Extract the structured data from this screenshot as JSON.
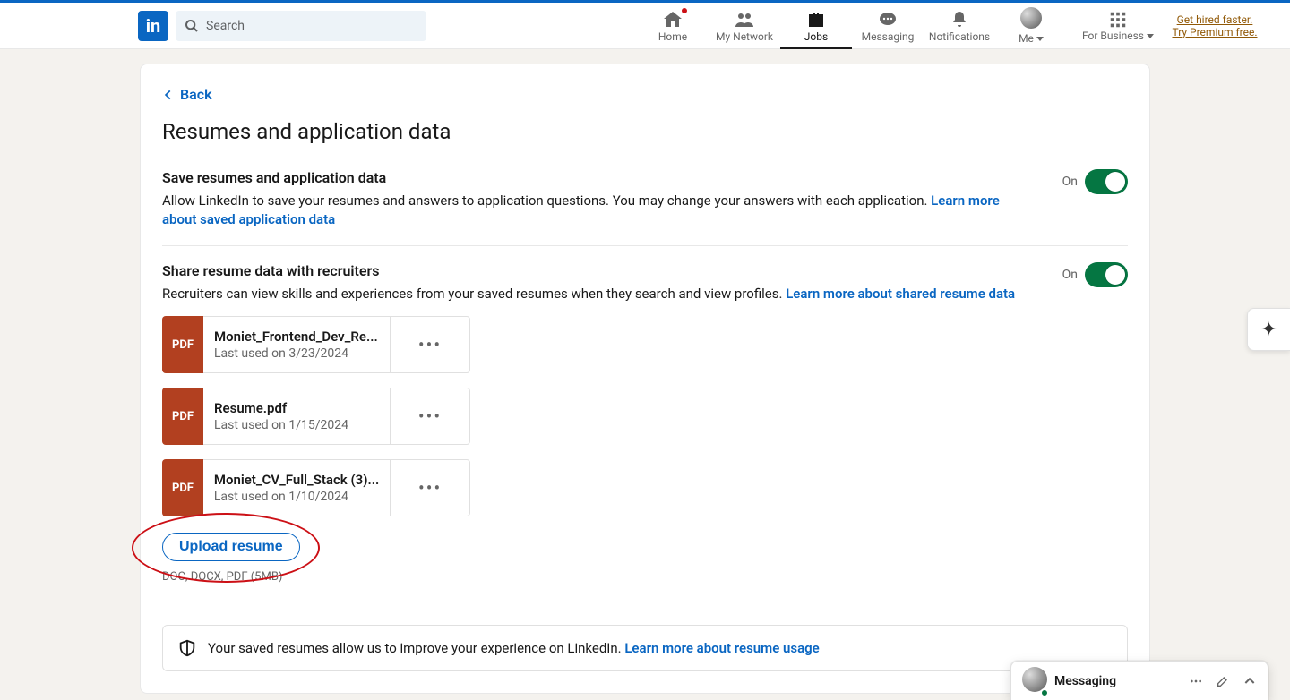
{
  "nav": {
    "search_placeholder": "Search",
    "items": {
      "home": "Home",
      "network": "My Network",
      "jobs": "Jobs",
      "messaging": "Messaging",
      "notifications": "Notifications",
      "me": "Me",
      "business": "For Business"
    },
    "premium_cta": "Get hired faster. Try Premium free."
  },
  "page": {
    "back_label": "Back",
    "title": "Resumes and application data"
  },
  "settings": {
    "save": {
      "title": "Save resumes and application data",
      "desc": "Allow LinkedIn to save your resumes and answers to application questions. You may change your answers with each application. ",
      "learn": "Learn more about saved application data",
      "state": "On"
    },
    "share": {
      "title": "Share resume data with recruiters",
      "desc": "Recruiters can view skills and experiences from your saved resumes when they search and view profiles. ",
      "learn": "Learn more about shared resume data",
      "state": "On"
    }
  },
  "resumes": [
    {
      "badge": "PDF",
      "name": "Moniet_Frontend_Dev_Re...",
      "date": "Last used on 3/23/2024"
    },
    {
      "badge": "PDF",
      "name": "Resume.pdf",
      "date": "Last used on 1/15/2024"
    },
    {
      "badge": "PDF",
      "name": "Moniet_CV_Full_Stack (3)...",
      "date": "Last used on 1/10/2024"
    }
  ],
  "upload": {
    "button": "Upload resume",
    "hint": "DOC, DOCX, PDF (5MB)"
  },
  "banner": {
    "text": "Your saved resumes allow us to improve your experience on LinkedIn. ",
    "learn": "Learn more about resume usage"
  },
  "messaging_dock": {
    "title": "Messaging"
  }
}
